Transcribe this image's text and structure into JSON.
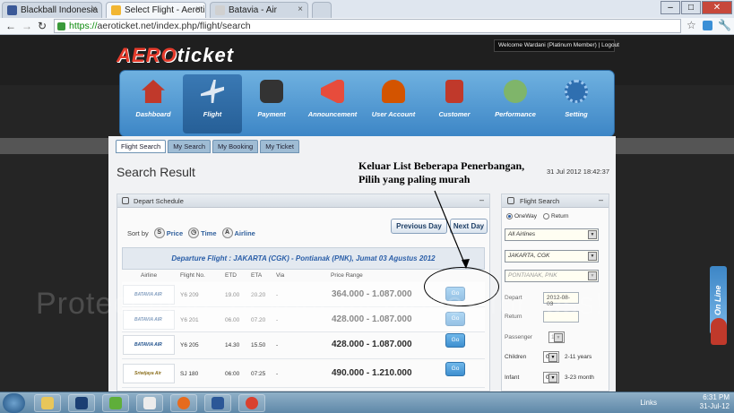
{
  "browser": {
    "tabs": [
      {
        "label": "Blackball Indonesia",
        "favicon_color": "#3b5998"
      },
      {
        "label": "Select Flight - Aeroticket",
        "favicon_color": "#f2b632"
      },
      {
        "label": "Batavia - Air",
        "favicon_color": "#d0d0d0"
      }
    ],
    "window_buttons": [
      "–",
      "□",
      "✕"
    ],
    "url_scheme": "https://",
    "url_rest": "aeroticket.net/index.php/flight/search"
  },
  "header": {
    "logo_part1": "AERO",
    "logo_part2": "ticket",
    "welcome": "Welcome Wardani (Platinum Member) | Logout"
  },
  "nav": [
    {
      "label": "Dashboard",
      "icon": "house-icon",
      "color": "#c0392b"
    },
    {
      "label": "Flight",
      "icon": "airplane-icon",
      "color": "#dfe8f2",
      "active": true
    },
    {
      "label": "Payment",
      "icon": "cube-icon",
      "color": "#333"
    },
    {
      "label": "Announcement",
      "icon": "megaphone-icon",
      "color": "#e74c3c"
    },
    {
      "label": "User Account",
      "icon": "user-icon",
      "color": "#d35400"
    },
    {
      "label": "Customer",
      "icon": "clipboard-icon",
      "color": "#c0392b"
    },
    {
      "label": "Performance",
      "icon": "gauge-icon",
      "color": "#7fb56a"
    },
    {
      "label": "Setting",
      "icon": "gear-icon",
      "color": "#2f6fb0"
    }
  ],
  "subtabs": [
    "Flight Search",
    "My Search",
    "My Booking",
    "My Ticket"
  ],
  "content": {
    "title": "Search Result",
    "datetime": "31 Jul 2012 18:42:37",
    "annotation_line1": "Keluar List Beberapa Penerbangan,",
    "annotation_line2": "Pilih yang paling murah"
  },
  "depart": {
    "panel_title": "Depart Schedule",
    "sort_label": "Sort by",
    "sort_options": [
      {
        "letter": "S",
        "label": "Price"
      },
      {
        "letter": "◷",
        "label": "Time"
      },
      {
        "letter": "A",
        "label": "Airline"
      }
    ],
    "prev_day": "Previous Day",
    "next_day": "Next Day",
    "route": "Departure Flight : JAKARTA (CGK) - Pontianak (PNK), Jumat 03 Agustus 2012",
    "columns": [
      "Airline",
      "Flight No.",
      "ETD",
      "ETA",
      "Via",
      "Price Range"
    ],
    "rows": [
      {
        "airline": "BATAVIA AIR",
        "flight": "Y6 209",
        "etd": "19.00",
        "eta": "20.20",
        "via": "-",
        "price": "364.000 - 1.087.000",
        "go": "Go"
      },
      {
        "airline": "BATAVIA AIR",
        "flight": "Y6 201",
        "etd": "06.00",
        "eta": "07.20",
        "via": "-",
        "price": "428.000 - 1.087.000",
        "go": "Go"
      },
      {
        "airline": "BATAVIA AIR",
        "flight": "Y6 205",
        "etd": "14.30",
        "eta": "15.50",
        "via": "-",
        "price": "428.000 - 1.087.000",
        "go": "Go"
      },
      {
        "airline": "Sriwijaya Air",
        "flight": "SJ 180",
        "etd": "06:00",
        "eta": "07:25",
        "via": "-",
        "price": "490.000 - 1.210.000",
        "go": "Go"
      }
    ]
  },
  "search": {
    "panel_title": "Flight Search",
    "oneway": "OneWay",
    "return": "Return",
    "airlines": "All Airlines",
    "from": "JAKARTA, CGK",
    "to": "PONTIANAK, PNK",
    "depart_label": "Depart",
    "depart_value": "2012-08-03",
    "return_label": "Return",
    "passenger_label": "Passenger",
    "passenger_value": "1",
    "children_label": "Children",
    "children_value": "0",
    "children_hint": "2-11 years",
    "infant_label": "Infant",
    "infant_value": "0",
    "infant_hint": "3-23 month"
  },
  "side_tab": "On Line",
  "watermark": "Protect more of your memories for less!",
  "taskbar": {
    "apps": [
      {
        "name": "explorer",
        "color": "#e8c65a"
      },
      {
        "name": "photoshop",
        "color": "#1b3f73"
      },
      {
        "name": "frog",
        "color": "#5fae3a"
      },
      {
        "name": "app4",
        "color": "#ececec"
      },
      {
        "name": "firefox",
        "color": "#e66b1e"
      },
      {
        "name": "word",
        "color": "#2b5797"
      },
      {
        "name": "chrome",
        "color": "#d9412f"
      }
    ],
    "links_label": "Links",
    "time": "6:31 PM",
    "date": "31-Jul-12"
  }
}
